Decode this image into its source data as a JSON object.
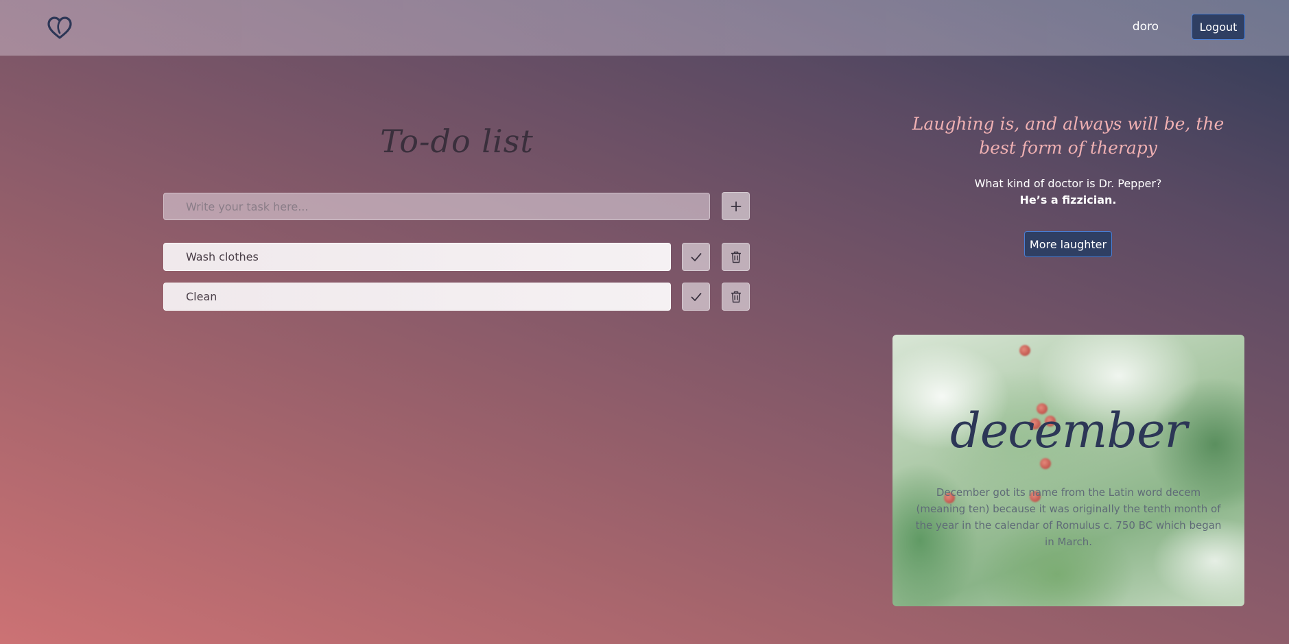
{
  "header": {
    "username": "doro",
    "logout_label": "Logout"
  },
  "todo": {
    "title": "To-do list",
    "input_placeholder": "Write your task here...",
    "input_value": "",
    "tasks": [
      {
        "label": "Wash clothes"
      },
      {
        "label": "Clean"
      }
    ]
  },
  "joke_panel": {
    "quote": "Laughing is, and always will be, the best form of therapy",
    "question": "What kind of doctor is Dr. Pepper?",
    "answer": "He’s a fizzician.",
    "button_label": "More laughter"
  },
  "month_card": {
    "name": "december",
    "description": "December got its name from the Latin word decem (meaning ten) because it was originally the tenth month of the year in the calendar of Romulus c. 750 BC which began in March."
  },
  "icons": {
    "logo": "heart-logo-icon",
    "add": "plus-icon",
    "done": "checkmark-icon",
    "delete": "trash-icon"
  },
  "colors": {
    "accent_button": "#2f3f63",
    "accent_border": "#4a7fd6",
    "quote_color": "#efb0b2",
    "month_title_color": "#2c3656"
  }
}
